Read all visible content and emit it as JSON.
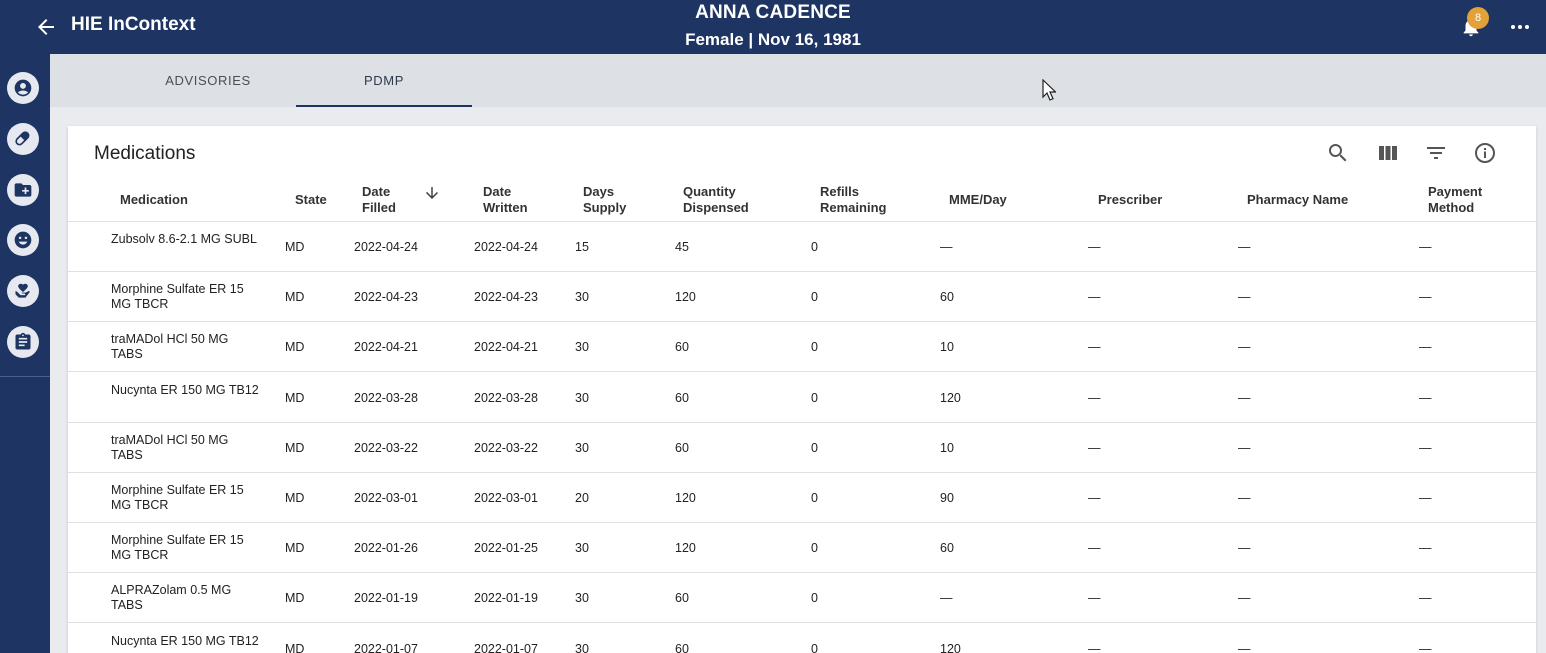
{
  "header": {
    "app_title": "HIE InContext",
    "patient_name": "ANNA CADENCE",
    "patient_info": "Female | Nov 16, 1981",
    "notification_count": "8"
  },
  "sidebar": {
    "items": [
      {
        "icon": "account-circle-icon"
      },
      {
        "icon": "pill-icon"
      },
      {
        "icon": "folder-add-icon"
      },
      {
        "icon": "emoji-icon"
      },
      {
        "icon": "hand-heart-icon"
      },
      {
        "icon": "clipboard-icon"
      }
    ]
  },
  "tabs": [
    {
      "label": "ADVISORIES",
      "active": false
    },
    {
      "label": "PDMP",
      "active": true
    }
  ],
  "medications": {
    "title": "Medications",
    "tools": [
      "search-icon",
      "columns-icon",
      "filter-icon",
      "info-icon"
    ],
    "columns": [
      {
        "line1": "Medication",
        "line2": ""
      },
      {
        "line1": "State",
        "line2": ""
      },
      {
        "line1": "Date",
        "line2": "Filled"
      },
      {
        "line1": "Date",
        "line2": "Written"
      },
      {
        "line1": "Days",
        "line2": "Supply"
      },
      {
        "line1": "Quantity",
        "line2": "Dispensed"
      },
      {
        "line1": "Refills",
        "line2": "Remaining"
      },
      {
        "line1": "MME/Day",
        "line2": ""
      },
      {
        "line1": "Prescriber",
        "line2": ""
      },
      {
        "line1": "Pharmacy Name",
        "line2": ""
      },
      {
        "line1": "Payment",
        "line2": "Method"
      }
    ],
    "rows": [
      {
        "medication": "Zubsolv 8.6-2.1 MG SUBL",
        "state": "MD",
        "date_filled": "2022-04-24",
        "date_written": "2022-04-24",
        "days_supply": "15",
        "quantity": "45",
        "refills": "0",
        "mme": "—",
        "prescriber": "—",
        "pharmacy": "—",
        "payment": "—"
      },
      {
        "medication": "Morphine Sulfate ER 15 MG TBCR",
        "state": "MD",
        "date_filled": "2022-04-23",
        "date_written": "2022-04-23",
        "days_supply": "30",
        "quantity": "120",
        "refills": "0",
        "mme": "60",
        "prescriber": "—",
        "pharmacy": "—",
        "payment": "—"
      },
      {
        "medication": "traMADol HCl 50 MG TABS",
        "state": "MD",
        "date_filled": "2022-04-21",
        "date_written": "2022-04-21",
        "days_supply": "30",
        "quantity": "60",
        "refills": "0",
        "mme": "10",
        "prescriber": "—",
        "pharmacy": "—",
        "payment": "—"
      },
      {
        "medication": "Nucynta ER 150 MG TB12",
        "state": "MD",
        "date_filled": "2022-03-28",
        "date_written": "2022-03-28",
        "days_supply": "30",
        "quantity": "60",
        "refills": "0",
        "mme": "120",
        "prescriber": "—",
        "pharmacy": "—",
        "payment": "—"
      },
      {
        "medication": "traMADol HCl 50 MG TABS",
        "state": "MD",
        "date_filled": "2022-03-22",
        "date_written": "2022-03-22",
        "days_supply": "30",
        "quantity": "60",
        "refills": "0",
        "mme": "10",
        "prescriber": "—",
        "pharmacy": "—",
        "payment": "—"
      },
      {
        "medication": "Morphine Sulfate ER 15 MG TBCR",
        "state": "MD",
        "date_filled": "2022-03-01",
        "date_written": "2022-03-01",
        "days_supply": "20",
        "quantity": "120",
        "refills": "0",
        "mme": "90",
        "prescriber": "—",
        "pharmacy": "—",
        "payment": "—"
      },
      {
        "medication": "Morphine Sulfate ER 15 MG TBCR",
        "state": "MD",
        "date_filled": "2022-01-26",
        "date_written": "2022-01-25",
        "days_supply": "30",
        "quantity": "120",
        "refills": "0",
        "mme": "60",
        "prescriber": "—",
        "pharmacy": "—",
        "payment": "—"
      },
      {
        "medication": "ALPRAZolam 0.5 MG TABS",
        "state": "MD",
        "date_filled": "2022-01-19",
        "date_written": "2022-01-19",
        "days_supply": "30",
        "quantity": "60",
        "refills": "0",
        "mme": "—",
        "prescriber": "—",
        "pharmacy": "—",
        "payment": "—"
      },
      {
        "medication": "Nucynta ER 150 MG TB12",
        "state": "MD",
        "date_filled": "2022-01-07",
        "date_written": "2022-01-07",
        "days_supply": "30",
        "quantity": "60",
        "refills": "0",
        "mme": "120",
        "prescriber": "—",
        "pharmacy": "—",
        "payment": "—"
      }
    ]
  },
  "colors": {
    "primary": "#1e3463",
    "badge": "#e3a13a",
    "tabbar": "#dde1e6"
  }
}
